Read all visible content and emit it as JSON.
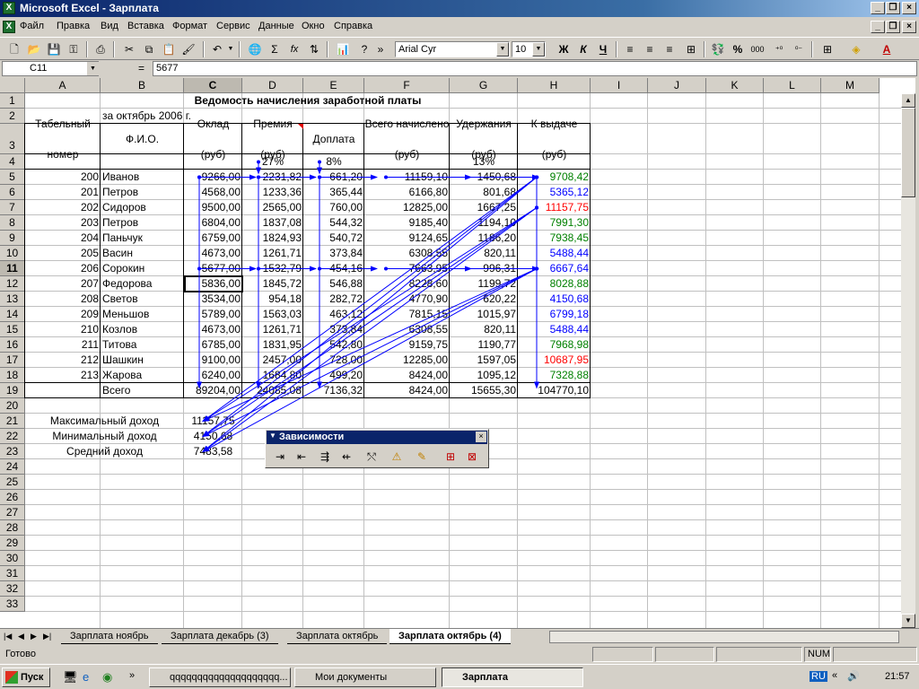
{
  "window": {
    "title": "Microsoft Excel - Зарплата"
  },
  "menu": [
    "Файл",
    "Правка",
    "Вид",
    "Вставка",
    "Формат",
    "Сервис",
    "Данные",
    "Окно",
    "Справка"
  ],
  "toolbar": {
    "font": "Arial Cyr",
    "size": "10",
    "bold": "Ж",
    "italic": "К",
    "underline": "Ч",
    "percent": "%",
    "thousands": "000",
    "sum": "Σ",
    "fx": "fx",
    "more": "»"
  },
  "formula": {
    "namebox": "C11",
    "eq": "=",
    "value": "5677"
  },
  "columns": [
    "A",
    "B",
    "C",
    "D",
    "E",
    "F",
    "G",
    "H",
    "I",
    "J",
    "K",
    "L",
    "M"
  ],
  "rows": [
    "1",
    "2",
    "3",
    "4",
    "5",
    "6",
    "7",
    "8",
    "9",
    "10",
    "11",
    "12",
    "13",
    "14",
    "15",
    "16",
    "17",
    "18",
    "19",
    "20",
    "21",
    "22",
    "23",
    "24",
    "25",
    "26",
    "27",
    "28",
    "29",
    "30",
    "31",
    "32",
    "33"
  ],
  "sheet": {
    "title": "Ведомость начисления заработной платы",
    "subtitle": "за октябрь 2006 г.",
    "headers": [
      "Табельный номер",
      "Ф.И.О.",
      "Оклад (руб)",
      "Премия (руб)",
      "Доплата",
      "Всего начислено (руб)",
      "Удержания (руб)",
      "К выдаче (руб)"
    ],
    "rates": {
      "premium": "27%",
      "extra": "8%",
      "deduct": "13%"
    },
    "data": [
      [
        "200",
        "Иванов",
        "9266,00",
        "2231,82",
        "661,20",
        "11159,10",
        "1450,68",
        "9708,42"
      ],
      [
        "201",
        "Петров",
        "4568,00",
        "1233,36",
        "365,44",
        "6166,80",
        "801,68",
        "5365,12"
      ],
      [
        "202",
        "Сидоров",
        "9500,00",
        "2565,00",
        "760,00",
        "12825,00",
        "1667,25",
        "11157,75"
      ],
      [
        "203",
        "Петров",
        "6804,00",
        "1837,08",
        "544,32",
        "9185,40",
        "1194,10",
        "7991,30"
      ],
      [
        "204",
        "Паньчук",
        "6759,00",
        "1824,93",
        "540,72",
        "9124,65",
        "1186,20",
        "7938,45"
      ],
      [
        "205",
        "Васин",
        "4673,00",
        "1261,71",
        "373,84",
        "6308,55",
        "820,11",
        "5488,44"
      ],
      [
        "206",
        "Сорокин",
        "5677,00",
        "1532,79",
        "454,16",
        "7663,95",
        "996,31",
        "6667,64"
      ],
      [
        "207",
        "Федорова",
        "5836,00",
        "1845,72",
        "546,88",
        "8228,60",
        "1199,72",
        "8028,88"
      ],
      [
        "208",
        "Светов",
        "3534,00",
        "954,18",
        "282,72",
        "4770,90",
        "620,22",
        "4150,68"
      ],
      [
        "209",
        "Меньшов",
        "5789,00",
        "1563,03",
        "463,12",
        "7815,15",
        "1015,97",
        "6799,18"
      ],
      [
        "210",
        "Козлов",
        "4673,00",
        "1261,71",
        "373,84",
        "6308,55",
        "820,11",
        "5488,44"
      ],
      [
        "211",
        "Титова",
        "6785,00",
        "1831,95",
        "542,80",
        "9159,75",
        "1190,77",
        "7968,98"
      ],
      [
        "212",
        "Шашкин",
        "9100,00",
        "2457,00",
        "728,00",
        "12285,00",
        "1597,05",
        "10687,95"
      ],
      [
        "213",
        "Жарова",
        "6240,00",
        "1684,80",
        "499,20",
        "8424,00",
        "1095,12",
        "7328,88"
      ]
    ],
    "payout_colors": [
      "#008000",
      "#0000ff",
      "#ff0000",
      "#008000",
      "#008000",
      "#0000ff",
      "#0000ff",
      "#008000",
      "#0000ff",
      "#0000ff",
      "#0000ff",
      "#008000",
      "#ff0000",
      "#008000"
    ],
    "total": [
      "Всего",
      "89204,00",
      "24085,08",
      "7136,32",
      "8424,00",
      "15655,30",
      "104770,10"
    ],
    "stats": [
      {
        "label": "Максимальный доход",
        "value": "11157,75"
      },
      {
        "label": "Минимальный доход",
        "value": "4150,68"
      },
      {
        "label": "Средний доход",
        "value": "7483,58"
      }
    ]
  },
  "palette": {
    "title": "Зависимости"
  },
  "tabs": [
    "Зарплата ноябрь",
    "Зарплата декабрь (3)",
    "Зарплата октябрь",
    "Зарплата октябрь (4)"
  ],
  "status": {
    "ready": "Готово",
    "num": "NUM"
  },
  "taskbar": {
    "start": "Пуск",
    "items": [
      "qqqqqqqqqqqqqqqqqqqq...",
      "Мои документы",
      "Зарплата"
    ],
    "lang": "RU",
    "time": "21:57"
  }
}
